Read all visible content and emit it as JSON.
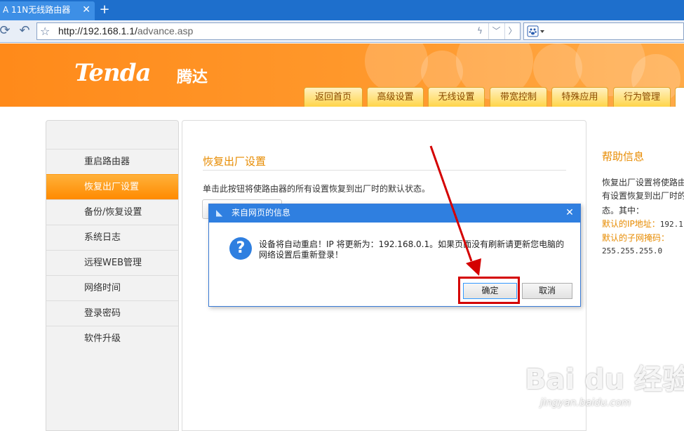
{
  "browser": {
    "tab_title": "A 11N无线路由器",
    "tab_close": "✕",
    "new_tab": "+",
    "address_host": "http://192.168.1.1/",
    "address_path": "advance.asp",
    "search_engine_icon": "paw-icon"
  },
  "header": {
    "logo": "Tenda",
    "logo_cn": "腾达",
    "tabs": [
      "返回首页",
      "高级设置",
      "无线设置",
      "带宽控制",
      "特殊应用",
      "行为管理"
    ],
    "colors": {
      "orange": "#ff8a1a",
      "accent_text": "#e78b00"
    }
  },
  "sidebar": {
    "items": [
      "重启路由器",
      "恢复出厂设置",
      "备份/恢复设置",
      "系统日志",
      "远程WEB管理",
      "网络时间",
      "登录密码",
      "软件升级"
    ],
    "active_index": 1
  },
  "main": {
    "title": "恢复出厂设置",
    "description": "单击此按钮将使路由器的所有设置恢复到出厂时的默认状态。",
    "restore_button": "恢复出厂设置"
  },
  "help": {
    "title": "帮助信息",
    "lines": [
      "恢复出厂设置将使路由",
      "有设置恢复到出厂时的",
      "态。其中："
    ],
    "default_ip_label": "默认的IP地址：",
    "default_ip_value": "192.1",
    "default_mask_label": "默认的子网掩码：",
    "default_mask_value": "255.255.255.0"
  },
  "dialog": {
    "title": "来自网页的信息",
    "close": "✕",
    "message_line1": "设备将自动重启！IP 将更新为：192.168.0.1。如果页面没有刷新请更新您电脑的",
    "message_line2": "网络设置后重新登录！",
    "ok_label": "确定",
    "cancel_label": "取消",
    "icon": "?"
  },
  "watermark": {
    "logo": "Bai du 经验",
    "url": "jingyan.baidu.com"
  }
}
